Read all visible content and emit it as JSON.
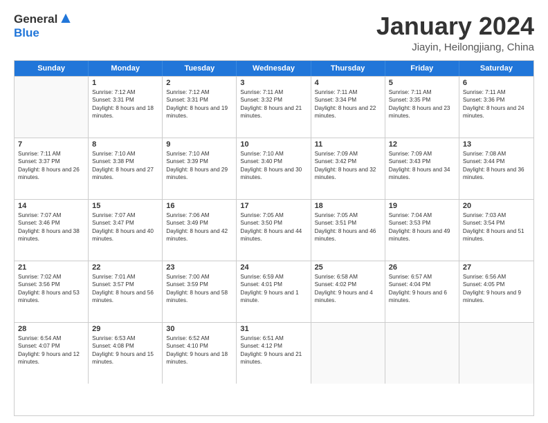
{
  "logo": {
    "general": "General",
    "blue": "Blue"
  },
  "header": {
    "title": "January 2024",
    "subtitle": "Jiayin, Heilongjiang, China"
  },
  "days": [
    "Sunday",
    "Monday",
    "Tuesday",
    "Wednesday",
    "Thursday",
    "Friday",
    "Saturday"
  ],
  "rows": [
    [
      {
        "day": "",
        "empty": true
      },
      {
        "day": "1",
        "sunrise": "Sunrise: 7:12 AM",
        "sunset": "Sunset: 3:31 PM",
        "daylight": "Daylight: 8 hours and 18 minutes."
      },
      {
        "day": "2",
        "sunrise": "Sunrise: 7:12 AM",
        "sunset": "Sunset: 3:31 PM",
        "daylight": "Daylight: 8 hours and 19 minutes."
      },
      {
        "day": "3",
        "sunrise": "Sunrise: 7:11 AM",
        "sunset": "Sunset: 3:32 PM",
        "daylight": "Daylight: 8 hours and 21 minutes."
      },
      {
        "day": "4",
        "sunrise": "Sunrise: 7:11 AM",
        "sunset": "Sunset: 3:34 PM",
        "daylight": "Daylight: 8 hours and 22 minutes."
      },
      {
        "day": "5",
        "sunrise": "Sunrise: 7:11 AM",
        "sunset": "Sunset: 3:35 PM",
        "daylight": "Daylight: 8 hours and 23 minutes."
      },
      {
        "day": "6",
        "sunrise": "Sunrise: 7:11 AM",
        "sunset": "Sunset: 3:36 PM",
        "daylight": "Daylight: 8 hours and 24 minutes."
      }
    ],
    [
      {
        "day": "7",
        "sunrise": "Sunrise: 7:11 AM",
        "sunset": "Sunset: 3:37 PM",
        "daylight": "Daylight: 8 hours and 26 minutes."
      },
      {
        "day": "8",
        "sunrise": "Sunrise: 7:10 AM",
        "sunset": "Sunset: 3:38 PM",
        "daylight": "Daylight: 8 hours and 27 minutes."
      },
      {
        "day": "9",
        "sunrise": "Sunrise: 7:10 AM",
        "sunset": "Sunset: 3:39 PM",
        "daylight": "Daylight: 8 hours and 29 minutes."
      },
      {
        "day": "10",
        "sunrise": "Sunrise: 7:10 AM",
        "sunset": "Sunset: 3:40 PM",
        "daylight": "Daylight: 8 hours and 30 minutes."
      },
      {
        "day": "11",
        "sunrise": "Sunrise: 7:09 AM",
        "sunset": "Sunset: 3:42 PM",
        "daylight": "Daylight: 8 hours and 32 minutes."
      },
      {
        "day": "12",
        "sunrise": "Sunrise: 7:09 AM",
        "sunset": "Sunset: 3:43 PM",
        "daylight": "Daylight: 8 hours and 34 minutes."
      },
      {
        "day": "13",
        "sunrise": "Sunrise: 7:08 AM",
        "sunset": "Sunset: 3:44 PM",
        "daylight": "Daylight: 8 hours and 36 minutes."
      }
    ],
    [
      {
        "day": "14",
        "sunrise": "Sunrise: 7:07 AM",
        "sunset": "Sunset: 3:46 PM",
        "daylight": "Daylight: 8 hours and 38 minutes."
      },
      {
        "day": "15",
        "sunrise": "Sunrise: 7:07 AM",
        "sunset": "Sunset: 3:47 PM",
        "daylight": "Daylight: 8 hours and 40 minutes."
      },
      {
        "day": "16",
        "sunrise": "Sunrise: 7:06 AM",
        "sunset": "Sunset: 3:49 PM",
        "daylight": "Daylight: 8 hours and 42 minutes."
      },
      {
        "day": "17",
        "sunrise": "Sunrise: 7:05 AM",
        "sunset": "Sunset: 3:50 PM",
        "daylight": "Daylight: 8 hours and 44 minutes."
      },
      {
        "day": "18",
        "sunrise": "Sunrise: 7:05 AM",
        "sunset": "Sunset: 3:51 PM",
        "daylight": "Daylight: 8 hours and 46 minutes."
      },
      {
        "day": "19",
        "sunrise": "Sunrise: 7:04 AM",
        "sunset": "Sunset: 3:53 PM",
        "daylight": "Daylight: 8 hours and 49 minutes."
      },
      {
        "day": "20",
        "sunrise": "Sunrise: 7:03 AM",
        "sunset": "Sunset: 3:54 PM",
        "daylight": "Daylight: 8 hours and 51 minutes."
      }
    ],
    [
      {
        "day": "21",
        "sunrise": "Sunrise: 7:02 AM",
        "sunset": "Sunset: 3:56 PM",
        "daylight": "Daylight: 8 hours and 53 minutes."
      },
      {
        "day": "22",
        "sunrise": "Sunrise: 7:01 AM",
        "sunset": "Sunset: 3:57 PM",
        "daylight": "Daylight: 8 hours and 56 minutes."
      },
      {
        "day": "23",
        "sunrise": "Sunrise: 7:00 AM",
        "sunset": "Sunset: 3:59 PM",
        "daylight": "Daylight: 8 hours and 58 minutes."
      },
      {
        "day": "24",
        "sunrise": "Sunrise: 6:59 AM",
        "sunset": "Sunset: 4:01 PM",
        "daylight": "Daylight: 9 hours and 1 minute."
      },
      {
        "day": "25",
        "sunrise": "Sunrise: 6:58 AM",
        "sunset": "Sunset: 4:02 PM",
        "daylight": "Daylight: 9 hours and 4 minutes."
      },
      {
        "day": "26",
        "sunrise": "Sunrise: 6:57 AM",
        "sunset": "Sunset: 4:04 PM",
        "daylight": "Daylight: 9 hours and 6 minutes."
      },
      {
        "day": "27",
        "sunrise": "Sunrise: 6:56 AM",
        "sunset": "Sunset: 4:05 PM",
        "daylight": "Daylight: 9 hours and 9 minutes."
      }
    ],
    [
      {
        "day": "28",
        "sunrise": "Sunrise: 6:54 AM",
        "sunset": "Sunset: 4:07 PM",
        "daylight": "Daylight: 9 hours and 12 minutes."
      },
      {
        "day": "29",
        "sunrise": "Sunrise: 6:53 AM",
        "sunset": "Sunset: 4:08 PM",
        "daylight": "Daylight: 9 hours and 15 minutes."
      },
      {
        "day": "30",
        "sunrise": "Sunrise: 6:52 AM",
        "sunset": "Sunset: 4:10 PM",
        "daylight": "Daylight: 9 hours and 18 minutes."
      },
      {
        "day": "31",
        "sunrise": "Sunrise: 6:51 AM",
        "sunset": "Sunset: 4:12 PM",
        "daylight": "Daylight: 9 hours and 21 minutes."
      },
      {
        "day": "",
        "empty": true
      },
      {
        "day": "",
        "empty": true
      },
      {
        "day": "",
        "empty": true
      }
    ]
  ]
}
